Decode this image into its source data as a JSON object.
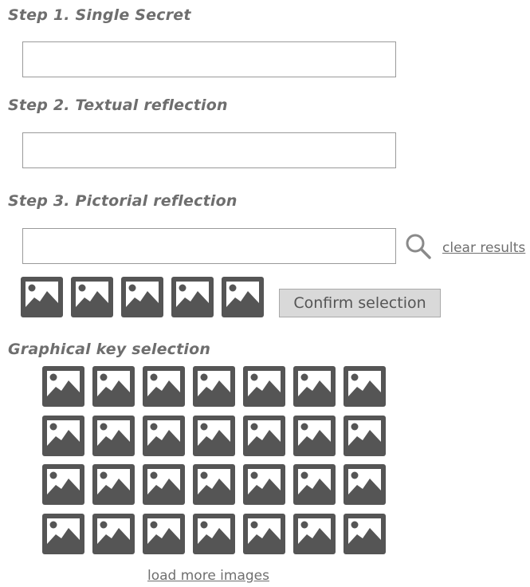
{
  "steps": [
    {
      "title": "Step 1. Single Secret",
      "input_value": ""
    },
    {
      "title": "Step 2. Textual reflection",
      "input_value": ""
    },
    {
      "title": "Step 3. Pictorial reflection",
      "input_value": ""
    }
  ],
  "pictorial": {
    "search_icon": "search-icon",
    "clear_label": "clear results",
    "selected_image_count": 5,
    "confirm_label": "Confirm selection"
  },
  "graphical_key": {
    "title": "Graphical key selection",
    "rows": 4,
    "columns": 7,
    "load_more_label": "load more images"
  },
  "icons": {
    "image_placeholder": "image-placeholder-icon"
  },
  "colors": {
    "heading": "#6e6e6e",
    "icon": "#555555",
    "input_border": "#9a9a9a",
    "button_bg": "#d9d9d9"
  }
}
